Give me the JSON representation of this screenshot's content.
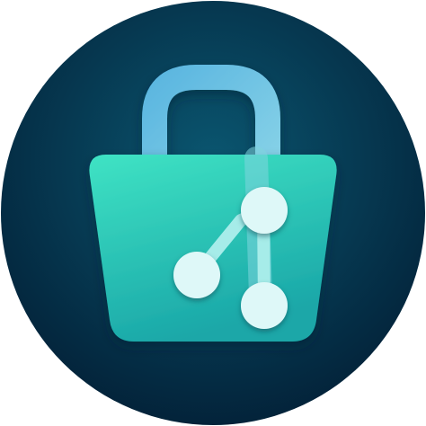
{
  "app_icon": {
    "icon_name": "shopping-bag-branch-icon",
    "colors": {
      "background_outer": "#03233a",
      "background_inner": "#0a5670",
      "handle_top": "#5bb6e0",
      "handle_bottom": "#8ad4e8",
      "bag_top": "#3fe3c4",
      "bag_bottom": "#1aa7a8",
      "branch_line": "#a6ece9",
      "node_fill": "#def8f8",
      "node_shadow": "#0d6f7a"
    }
  }
}
